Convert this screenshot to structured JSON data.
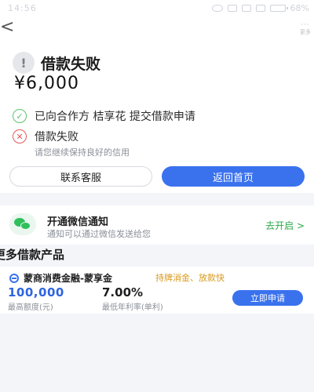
{
  "status_bar": {
    "time": "14:56",
    "battery": "68%"
  },
  "nav": {
    "back_symbol": "<",
    "more_label": "更多"
  },
  "result": {
    "title": "借款失败",
    "amount": "¥6,000",
    "steps": [
      {
        "text": "已向合作方 桔享花 提交借款申请",
        "status": "success"
      },
      {
        "text": "借款失败",
        "sub": "请您继续保持良好的信用",
        "status": "fail"
      }
    ],
    "buttons": {
      "service": "联系客服",
      "home": "返回首页"
    }
  },
  "notify": {
    "title": "开通微信通知",
    "subtitle": "通知可以通过微信发送给您",
    "link": "去开启 >"
  },
  "more_products": {
    "title": "更多借款产品",
    "items": [
      {
        "name": "蒙商消费金融-蒙享金",
        "tags": "持牌消金、放款快",
        "amount": "100,000",
        "amount_label": "最高额度(元)",
        "rate": "7.00%",
        "rate_label": "最低年利率(单利)",
        "apply_label": "立即申请"
      }
    ]
  },
  "colors": {
    "accent": "#3a72ee",
    "success": "#59c46f",
    "fail": "#e25b5b",
    "tag": "#d99a1d",
    "wechat": "#2fbf5b"
  }
}
